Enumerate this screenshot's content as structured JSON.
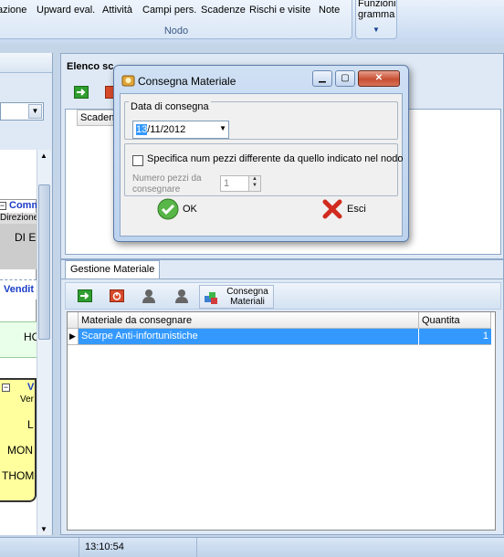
{
  "ribbon": {
    "items": [
      "azione",
      "Upward eval.",
      "Attività",
      "Campi pers.",
      "Scadenze",
      "Rischi e visite",
      "Note"
    ],
    "group_label": "Nodo",
    "funzioni_label": "Funzioni gramma"
  },
  "left_panel": {
    "node1_header": "Comm",
    "node1_sub": "Direzione",
    "node1_body": "DI E",
    "blue_row": "Vendit",
    "green_box": "HC",
    "yellow_header": "V",
    "yellow_sub": "Ver",
    "yellow_lines": [
      "L",
      "MON",
      "THOM"
    ]
  },
  "elenco": {
    "title": "Elenco sc",
    "grid_header": "Scadenz"
  },
  "gestione": {
    "tab_label": "Gestione Materiale",
    "consegna_label": "Consegna Materiali",
    "columns": [
      "Materiale da consegnare",
      "Quantita"
    ],
    "rows": [
      {
        "materiale": "Scarpe Anti-infortunistiche",
        "quantita": "1"
      }
    ]
  },
  "status": {
    "time": "13:10:54"
  },
  "dialog": {
    "title": "Consegna Materiale",
    "data_legend": "Data di consegna",
    "date_day": "13",
    "date_rest": "/11/2012",
    "checkbox_label": "Specifica num pezzi differente da quello indicato nel nodo",
    "num_pezzi_label": "Numero pezzi da consegnare",
    "num_pezzi_value": "1",
    "ok_label": "OK",
    "esci_label": "Esci"
  }
}
